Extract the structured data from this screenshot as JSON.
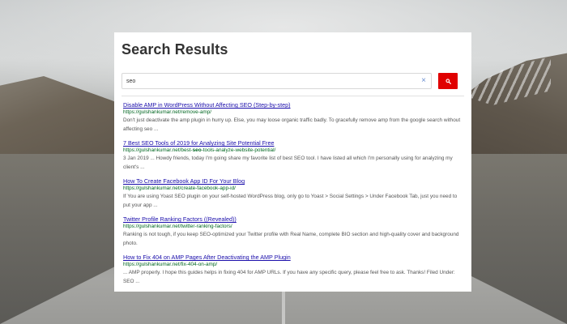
{
  "page": {
    "title": "Search Results"
  },
  "search": {
    "value": "seo",
    "clear_icon": "×",
    "button_icon": "search-icon"
  },
  "colors": {
    "accent": "#e00000",
    "link": "#1a0dab",
    "url": "#006621",
    "snippet": "#545454"
  },
  "results": [
    {
      "title": "Disable AMP in WordPress Without Affecting SEO (Step-by-step)",
      "url_pre": "https://gulshankumar.net/remove-amp/",
      "url_bold": "",
      "url_post": "",
      "snippet": "Don't just deactivate the amp plugin in hurry up. Else, you may loose organic traffic badly. To gracefully remove amp from the google search without affecting seo ..."
    },
    {
      "title": "7 Best SEO Tools of 2019 for Analyzing Site Potential Free",
      "url_pre": "https://gulshankumar.net/best-",
      "url_bold": "seo",
      "url_post": "-tools-analyze-website-potential/",
      "snippet": "3 Jan 2019 ... Howdy friends, today I'm going share my favorite list of best SEO tool. I have listed all which I'm personally using for analyzing my client's ..."
    },
    {
      "title": "How To Create Facebook App ID For Your Blog",
      "url_pre": "https://gulshankumar.net/create-facebook-app-id/",
      "url_bold": "",
      "url_post": "",
      "snippet": "If You are using Yoast SEO plugin on your self-hosted WordPress blog, only go to Yoast > Social Settings > Under Facebook Tab, just you need to put your app ..."
    },
    {
      "title": "Twitter Profile Ranking Factors ((Revealed))",
      "url_pre": "https://gulshankumar.net/twitter-ranking-factors/",
      "url_bold": "",
      "url_post": "",
      "snippet": "Ranking is not tough, if you keep SEO-optimized your Twitter profile with Real Name, complete BIO section and high-quality cover and background photo."
    },
    {
      "title": "How to Fix 404 on AMP Pages After Deactivating the AMP Plugin",
      "url_pre": "https://gulshankumar.net/fix-404-on-amp/",
      "url_bold": "",
      "url_post": "",
      "snippet": "... AMP properly. I hope this guides helps in fixing 404 for AMP URLs. If you have any specific query, please feel free to ask. Thanks! Filed Under: SEO ..."
    }
  ]
}
